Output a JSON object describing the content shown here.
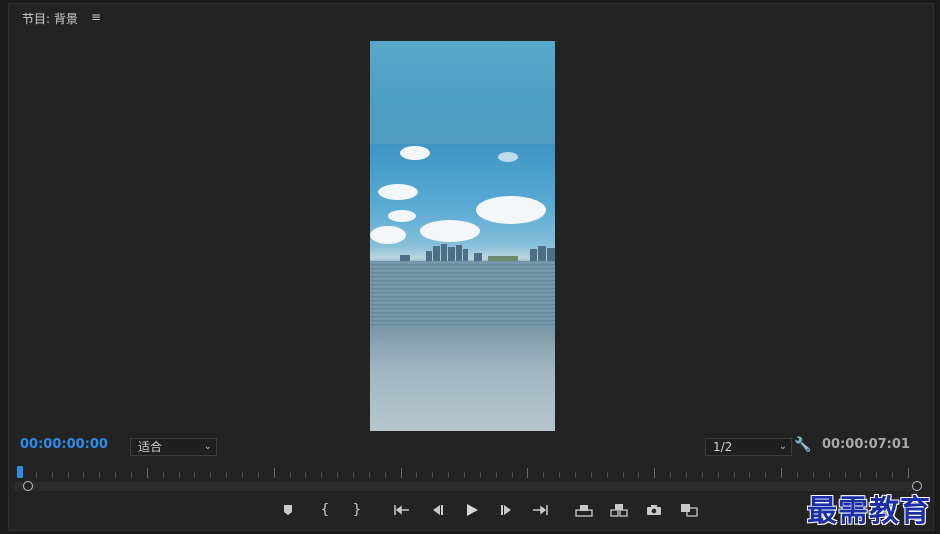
{
  "panel": {
    "title": "节目: 背景",
    "menu_icon": "hamburger-menu-icon"
  },
  "timecode": {
    "current": "00:00:00:00",
    "duration": "00:00:07:01"
  },
  "zoom_select": {
    "value": "适合"
  },
  "resolution_select": {
    "value": "1/2"
  },
  "playhead": {
    "position_fraction": 0.0
  },
  "icons": {
    "settings": "wrench-icon",
    "marker": "add-marker-icon",
    "mark_in": "mark-in-icon",
    "mark_out": "mark-out-icon",
    "go_to_in": "go-to-in-icon",
    "step_back": "step-back-icon",
    "play": "play-icon",
    "step_forward": "step-forward-icon",
    "go_to_out": "go-to-out-icon",
    "lift": "lift-icon",
    "extract": "extract-icon",
    "export_frame": "camera-icon",
    "comparison_view": "comparison-view-icon"
  },
  "watermark": {
    "text": "最需教育"
  },
  "colors": {
    "accent": "#2d8ceb",
    "panel_bg": "#232323",
    "text": "#d0d0d0"
  }
}
